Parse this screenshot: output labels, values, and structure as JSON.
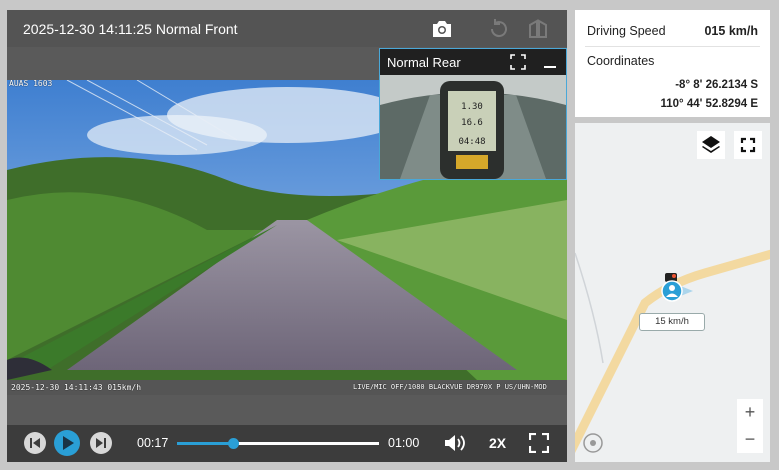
{
  "player": {
    "title": "2025-12-30 14:11:25 Normal Front",
    "pip_label": "Normal Rear",
    "osd_top_left": "AUAS 1603",
    "osd_bottom_left": "2025-12-30 14:11:43 015km/h",
    "osd_bottom_right": "LIVE/MIC OFF/1080 BLACKVUE DR970X P US/UHN-MOD",
    "current_time": "00:17",
    "duration": "01:00",
    "progress": 0.28,
    "playback_rate": "2X"
  },
  "info": {
    "speed_label": "Driving Speed",
    "speed_value": "015 km/h",
    "coordinates_label": "Coordinates",
    "latitude": "-8° 8' 26.2134 S",
    "longitude": "110° 44' 52.8294 E"
  },
  "map": {
    "speed_tag": "15 km/h",
    "zoom_in": "+",
    "zoom_out": "−"
  },
  "colors": {
    "accent": "#2a9fd6",
    "route": "#f3d9a0"
  }
}
